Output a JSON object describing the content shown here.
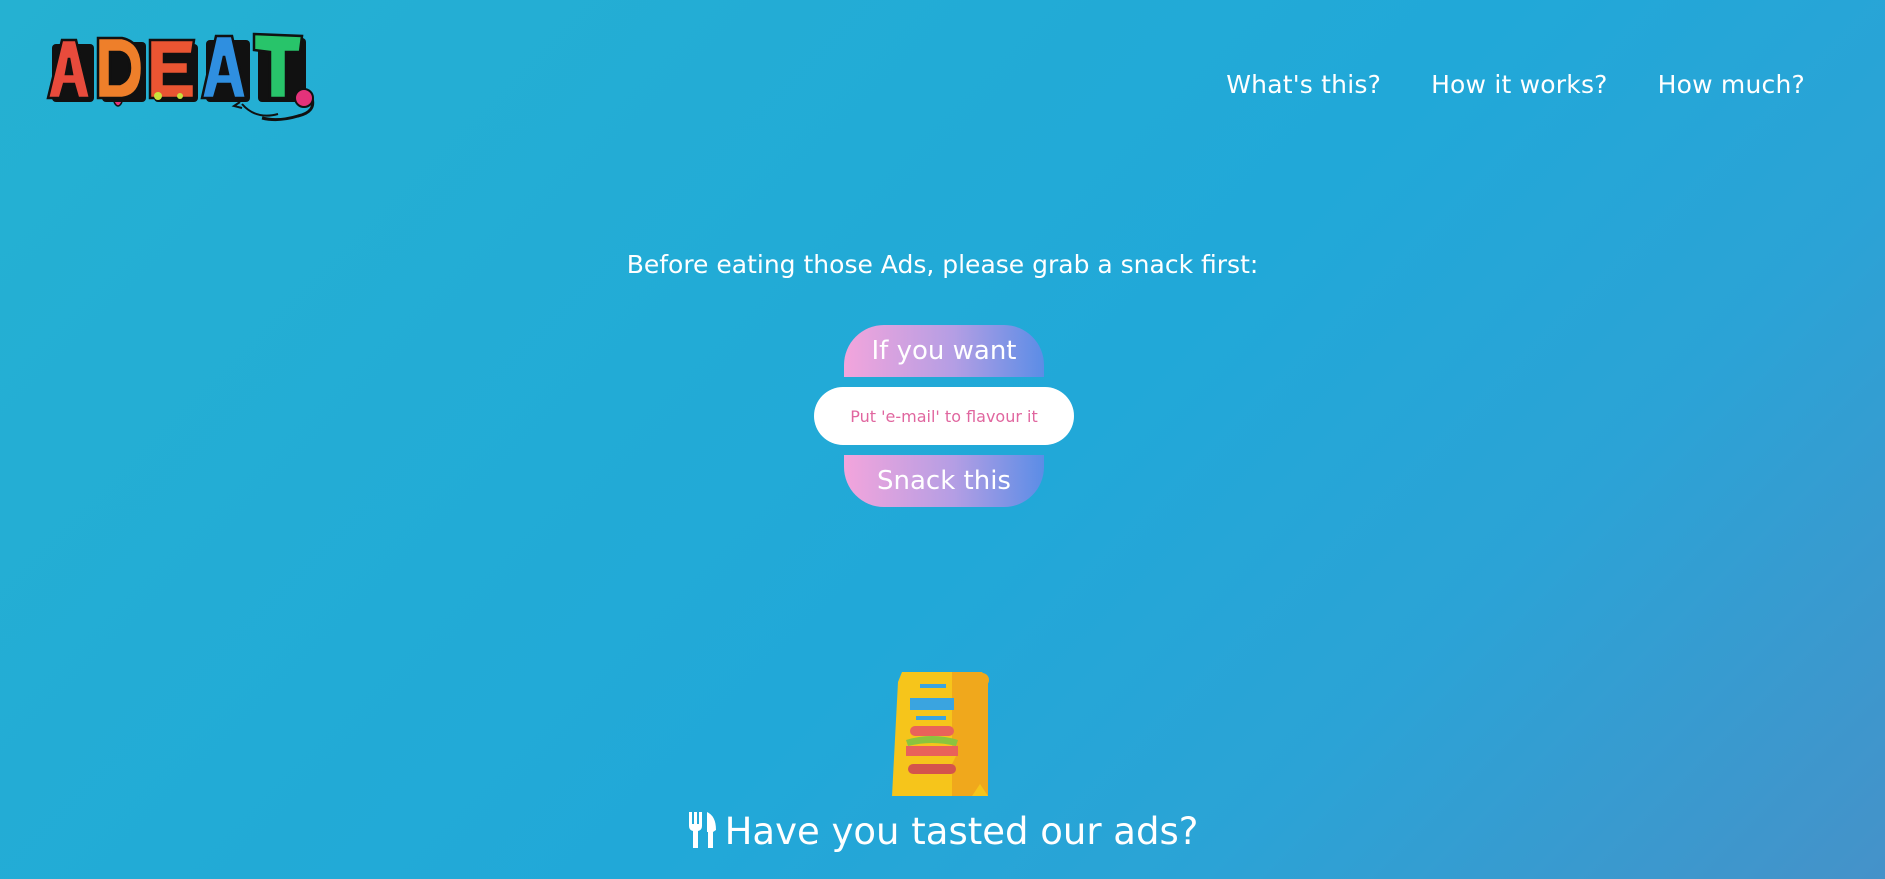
{
  "logo": {
    "letters": [
      "A",
      "D",
      "E",
      "A",
      "T"
    ],
    "colors": [
      "#e84b3c",
      "#ee7f2a",
      "#ea5532",
      "#2f8fe0",
      "#28c46a"
    ]
  },
  "nav": {
    "items": [
      {
        "label": "What's this?"
      },
      {
        "label": "How it works?"
      },
      {
        "label": "How much?"
      }
    ]
  },
  "hero": {
    "prompt": "Before eating those Ads, please grab a snack first:",
    "top_button": "If you want",
    "email_placeholder": "Put 'e-mail' to flavour it",
    "submit_button": "Snack this"
  },
  "section": {
    "title": "Have you tasted our ads?",
    "title_icon": "fork-knife-icon",
    "illustration_icon": "food-bag-icon"
  },
  "colors": {
    "gradient_pink": "#f3a5dc",
    "gradient_blue": "#5b8de6",
    "placeholder": "#e0669f"
  }
}
